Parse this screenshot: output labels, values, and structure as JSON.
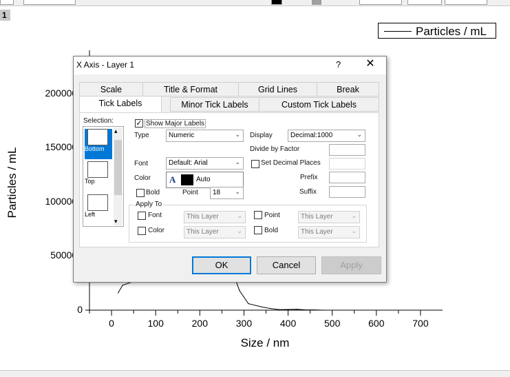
{
  "layer_badge": "1",
  "legend": {
    "label": "Particles / mL"
  },
  "colors": {
    "accent": "#0078d7",
    "selection": "#0078d7",
    "dialog_bg": "#f0f0f0"
  },
  "chart_data": {
    "type": "line",
    "title": "",
    "xlabel": "Size / nm",
    "ylabel": "Particles / mL",
    "xlim": [
      -50,
      750
    ],
    "ylim": [
      0,
      2400000
    ],
    "x_ticks": [
      "0",
      "100",
      "200",
      "300",
      "400",
      "500",
      "600",
      "700"
    ],
    "y_ticks": [
      "0",
      "500000",
      "1000000",
      "1500000",
      "2000000"
    ],
    "series": [
      {
        "name": "Particles / mL",
        "x": [
          15,
          25,
          210,
          270,
          290,
          310,
          340,
          360,
          380,
          420,
          440,
          460,
          480,
          500
        ],
        "y": [
          160000,
          230000,
          490000,
          400000,
          180000,
          60000,
          30000,
          15000,
          5000,
          8000,
          2000,
          2000,
          0,
          0
        ]
      }
    ]
  },
  "dialog": {
    "title": "X Axis - Layer 1",
    "help": "?",
    "close": "✕",
    "tabs_row1": [
      "Scale",
      "Title & Format",
      "Grid Lines",
      "Break"
    ],
    "tabs_row2": [
      "Tick Labels",
      "Minor Tick Labels",
      "Custom Tick Labels"
    ],
    "active_tab": "Tick Labels",
    "selection_label": "Selection:",
    "selection_items": [
      "Bottom",
      "Top",
      "Left"
    ],
    "show_major_labels": "Show Major Labels",
    "show_major_checked": "✓",
    "type_label": "Type",
    "type_value": "Numeric",
    "display_label": "Display",
    "display_value": "Decimal:1000",
    "divide_label": "Divide by Factor",
    "font_label": "Font",
    "font_value": "Default: Arial",
    "set_decimal_label": "Set Decimal Places",
    "color_label": "Color",
    "color_value": "Auto",
    "color_icon_glyph": "A",
    "prefix_label": "Prefix",
    "bold_label": "Bold",
    "point_label": "Point",
    "point_value": "18",
    "suffix_label": "Suffix",
    "apply_to_label": "Apply To",
    "apply_font": "Font",
    "apply_color": "Color",
    "apply_point": "Point",
    "apply_bold": "Bold",
    "this_layer": "This Layer",
    "ok": "OK",
    "cancel": "Cancel",
    "apply": "Apply"
  }
}
